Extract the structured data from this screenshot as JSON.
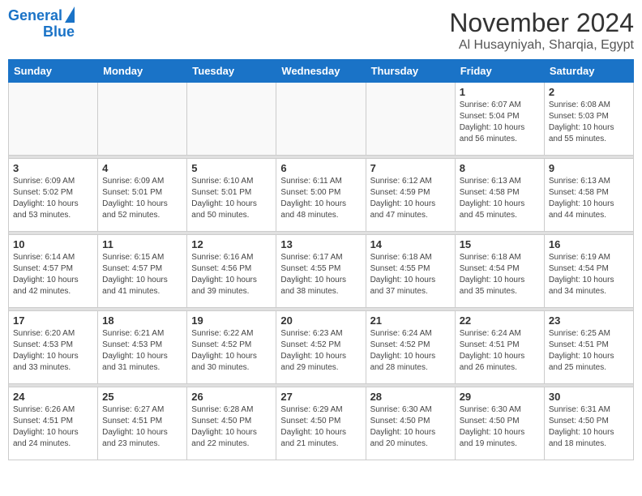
{
  "logo": {
    "line1": "General",
    "line2": "Blue"
  },
  "title": "November 2024",
  "subtitle": "Al Husayniyah, Sharqia, Egypt",
  "weekdays": [
    "Sunday",
    "Monday",
    "Tuesday",
    "Wednesday",
    "Thursday",
    "Friday",
    "Saturday"
  ],
  "weeks": [
    [
      {
        "day": "",
        "info": ""
      },
      {
        "day": "",
        "info": ""
      },
      {
        "day": "",
        "info": ""
      },
      {
        "day": "",
        "info": ""
      },
      {
        "day": "",
        "info": ""
      },
      {
        "day": "1",
        "info": "Sunrise: 6:07 AM\nSunset: 5:04 PM\nDaylight: 10 hours\nand 56 minutes."
      },
      {
        "day": "2",
        "info": "Sunrise: 6:08 AM\nSunset: 5:03 PM\nDaylight: 10 hours\nand 55 minutes."
      }
    ],
    [
      {
        "day": "3",
        "info": "Sunrise: 6:09 AM\nSunset: 5:02 PM\nDaylight: 10 hours\nand 53 minutes."
      },
      {
        "day": "4",
        "info": "Sunrise: 6:09 AM\nSunset: 5:01 PM\nDaylight: 10 hours\nand 52 minutes."
      },
      {
        "day": "5",
        "info": "Sunrise: 6:10 AM\nSunset: 5:01 PM\nDaylight: 10 hours\nand 50 minutes."
      },
      {
        "day": "6",
        "info": "Sunrise: 6:11 AM\nSunset: 5:00 PM\nDaylight: 10 hours\nand 48 minutes."
      },
      {
        "day": "7",
        "info": "Sunrise: 6:12 AM\nSunset: 4:59 PM\nDaylight: 10 hours\nand 47 minutes."
      },
      {
        "day": "8",
        "info": "Sunrise: 6:13 AM\nSunset: 4:58 PM\nDaylight: 10 hours\nand 45 minutes."
      },
      {
        "day": "9",
        "info": "Sunrise: 6:13 AM\nSunset: 4:58 PM\nDaylight: 10 hours\nand 44 minutes."
      }
    ],
    [
      {
        "day": "10",
        "info": "Sunrise: 6:14 AM\nSunset: 4:57 PM\nDaylight: 10 hours\nand 42 minutes."
      },
      {
        "day": "11",
        "info": "Sunrise: 6:15 AM\nSunset: 4:57 PM\nDaylight: 10 hours\nand 41 minutes."
      },
      {
        "day": "12",
        "info": "Sunrise: 6:16 AM\nSunset: 4:56 PM\nDaylight: 10 hours\nand 39 minutes."
      },
      {
        "day": "13",
        "info": "Sunrise: 6:17 AM\nSunset: 4:55 PM\nDaylight: 10 hours\nand 38 minutes."
      },
      {
        "day": "14",
        "info": "Sunrise: 6:18 AM\nSunset: 4:55 PM\nDaylight: 10 hours\nand 37 minutes."
      },
      {
        "day": "15",
        "info": "Sunrise: 6:18 AM\nSunset: 4:54 PM\nDaylight: 10 hours\nand 35 minutes."
      },
      {
        "day": "16",
        "info": "Sunrise: 6:19 AM\nSunset: 4:54 PM\nDaylight: 10 hours\nand 34 minutes."
      }
    ],
    [
      {
        "day": "17",
        "info": "Sunrise: 6:20 AM\nSunset: 4:53 PM\nDaylight: 10 hours\nand 33 minutes."
      },
      {
        "day": "18",
        "info": "Sunrise: 6:21 AM\nSunset: 4:53 PM\nDaylight: 10 hours\nand 31 minutes."
      },
      {
        "day": "19",
        "info": "Sunrise: 6:22 AM\nSunset: 4:52 PM\nDaylight: 10 hours\nand 30 minutes."
      },
      {
        "day": "20",
        "info": "Sunrise: 6:23 AM\nSunset: 4:52 PM\nDaylight: 10 hours\nand 29 minutes."
      },
      {
        "day": "21",
        "info": "Sunrise: 6:24 AM\nSunset: 4:52 PM\nDaylight: 10 hours\nand 28 minutes."
      },
      {
        "day": "22",
        "info": "Sunrise: 6:24 AM\nSunset: 4:51 PM\nDaylight: 10 hours\nand 26 minutes."
      },
      {
        "day": "23",
        "info": "Sunrise: 6:25 AM\nSunset: 4:51 PM\nDaylight: 10 hours\nand 25 minutes."
      }
    ],
    [
      {
        "day": "24",
        "info": "Sunrise: 6:26 AM\nSunset: 4:51 PM\nDaylight: 10 hours\nand 24 minutes."
      },
      {
        "day": "25",
        "info": "Sunrise: 6:27 AM\nSunset: 4:51 PM\nDaylight: 10 hours\nand 23 minutes."
      },
      {
        "day": "26",
        "info": "Sunrise: 6:28 AM\nSunset: 4:50 PM\nDaylight: 10 hours\nand 22 minutes."
      },
      {
        "day": "27",
        "info": "Sunrise: 6:29 AM\nSunset: 4:50 PM\nDaylight: 10 hours\nand 21 minutes."
      },
      {
        "day": "28",
        "info": "Sunrise: 6:30 AM\nSunset: 4:50 PM\nDaylight: 10 hours\nand 20 minutes."
      },
      {
        "day": "29",
        "info": "Sunrise: 6:30 AM\nSunset: 4:50 PM\nDaylight: 10 hours\nand 19 minutes."
      },
      {
        "day": "30",
        "info": "Sunrise: 6:31 AM\nSunset: 4:50 PM\nDaylight: 10 hours\nand 18 minutes."
      }
    ]
  ]
}
